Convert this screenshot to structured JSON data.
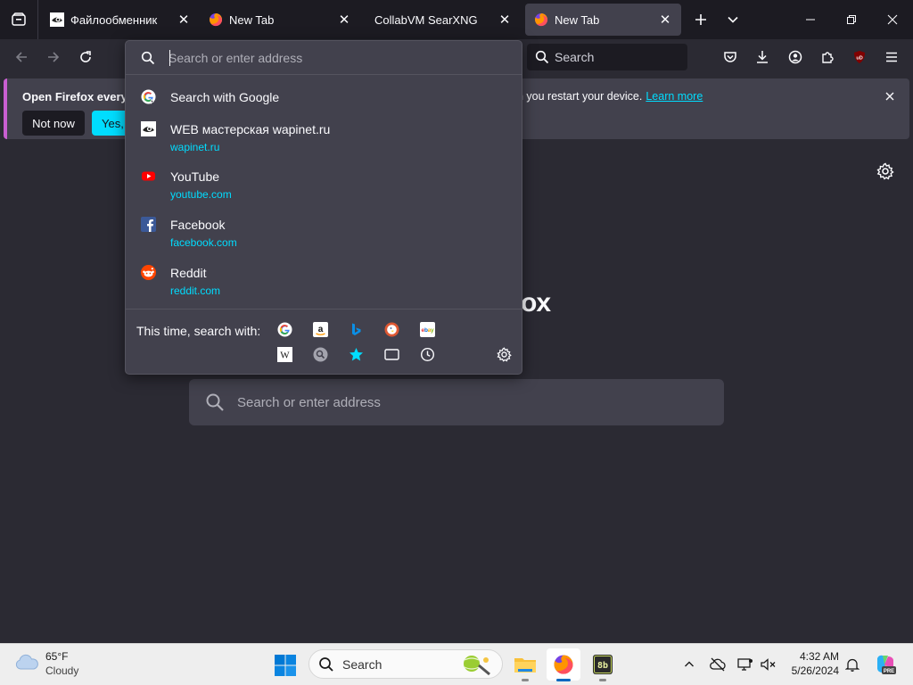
{
  "tabs": [
    {
      "title": "Файлообменник",
      "favicon": "eye-logo-icon",
      "active": false
    },
    {
      "title": "New Tab",
      "favicon": "firefox-icon",
      "active": false
    },
    {
      "title": "CollabVM SearXNG",
      "favicon": "none",
      "active": false
    },
    {
      "title": "New Tab",
      "favicon": "firefox-icon",
      "active": true
    }
  ],
  "toolbar": {
    "search_placeholder": "Search"
  },
  "notification": {
    "bold_text": "Open Firefox every ti",
    "text_tail": "n you restart your device.",
    "link": "Learn more",
    "not_now": "Not now",
    "yes_partial": "Yes, c"
  },
  "urlbar": {
    "placeholder": "Search or enter address",
    "results": [
      {
        "title": "Search with Google",
        "url": "",
        "icon": "google-icon"
      },
      {
        "title": "WEB мастерская wapinet.ru",
        "url": "wapinet.ru",
        "icon": "wapinet-icon"
      },
      {
        "title": "YouTube",
        "url": "youtube.com",
        "icon": "youtube-icon"
      },
      {
        "title": "Facebook",
        "url": "facebook.com",
        "icon": "facebook-icon"
      },
      {
        "title": "Reddit",
        "url": "reddit.com",
        "icon": "reddit-icon"
      }
    ],
    "oneoff_label": "This time, search with:",
    "oneoff_engines": [
      "google-icon",
      "amazon-icon",
      "bing-icon",
      "duckduckgo-icon",
      "ebay-icon",
      "wikipedia-icon",
      "searxng-icon",
      "bookmarks-icon",
      "tabs-icon",
      "history-icon",
      "search-settings-icon"
    ]
  },
  "page": {
    "brand_partial": "ox",
    "search_placeholder": "Search or enter address"
  },
  "taskbar": {
    "weather_temp": "65°F",
    "weather_condition": "Cloudy",
    "search_label": "Search",
    "time": "4:32 AM",
    "date": "5/26/2024"
  },
  "colors": {
    "accent": "#00ddff",
    "panel": "#42414d",
    "background": "#2b2a33",
    "tabstrip": "#1c1b22"
  }
}
